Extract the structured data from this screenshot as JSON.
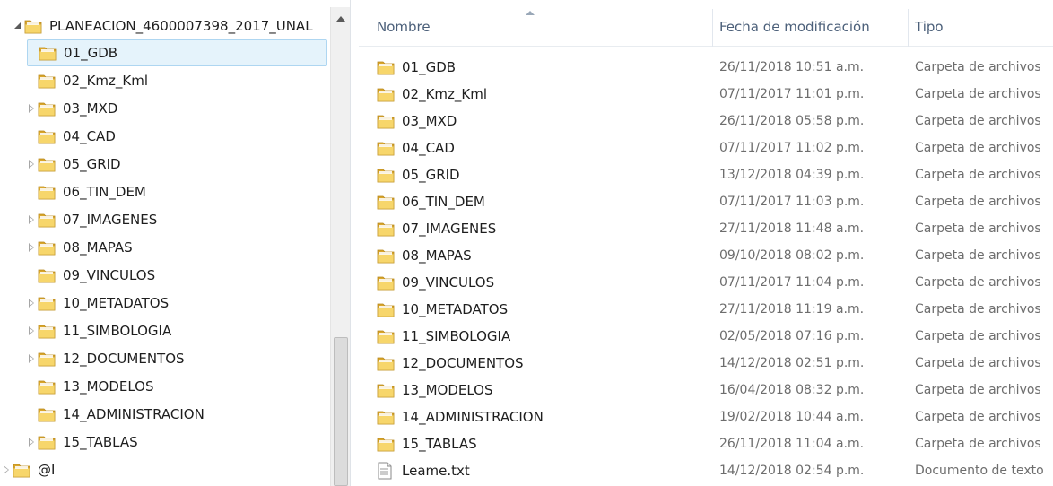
{
  "nav": {
    "root": {
      "label": "PLANEACION_4600007398_2017_UNAL"
    },
    "children": [
      {
        "label": "01_GDB",
        "expandable": false,
        "selected": true
      },
      {
        "label": "02_Kmz_Kml",
        "expandable": false
      },
      {
        "label": "03_MXD",
        "expandable": true
      },
      {
        "label": "04_CAD",
        "expandable": false
      },
      {
        "label": "05_GRID",
        "expandable": true
      },
      {
        "label": "06_TIN_DEM",
        "expandable": false
      },
      {
        "label": "07_IMAGENES",
        "expandable": true
      },
      {
        "label": "08_MAPAS",
        "expandable": true
      },
      {
        "label": "09_VINCULOS",
        "expandable": false
      },
      {
        "label": "10_METADATOS",
        "expandable": true
      },
      {
        "label": "11_SIMBOLOGIA",
        "expandable": true
      },
      {
        "label": "12_DOCUMENTOS",
        "expandable": true
      },
      {
        "label": "13_MODELOS",
        "expandable": false
      },
      {
        "label": "14_ADMINISTRACION",
        "expandable": false
      },
      {
        "label": "15_TABLAS",
        "expandable": true
      }
    ],
    "sibling": {
      "label": "@I"
    }
  },
  "columns": {
    "name": "Nombre",
    "date": "Fecha de modificación",
    "type": "Tipo"
  },
  "files": [
    {
      "name": "01_GDB",
      "date": "26/11/2018 10:51 a.m.",
      "type": "Carpeta de archivos",
      "icon": "folder-icon"
    },
    {
      "name": "02_Kmz_Kml",
      "date": "07/11/2017 11:01 p.m.",
      "type": "Carpeta de archivos",
      "icon": "folder-icon"
    },
    {
      "name": "03_MXD",
      "date": "26/11/2018 05:58 p.m.",
      "type": "Carpeta de archivos",
      "icon": "folder-icon"
    },
    {
      "name": "04_CAD",
      "date": "07/11/2017 11:02 p.m.",
      "type": "Carpeta de archivos",
      "icon": "folder-icon"
    },
    {
      "name": "05_GRID",
      "date": "13/12/2018 04:39 p.m.",
      "type": "Carpeta de archivos",
      "icon": "folder-icon"
    },
    {
      "name": "06_TIN_DEM",
      "date": "07/11/2017 11:03 p.m.",
      "type": "Carpeta de archivos",
      "icon": "folder-icon"
    },
    {
      "name": "07_IMAGENES",
      "date": "27/11/2018 11:48 a.m.",
      "type": "Carpeta de archivos",
      "icon": "folder-icon"
    },
    {
      "name": "08_MAPAS",
      "date": "09/10/2018 08:02 p.m.",
      "type": "Carpeta de archivos",
      "icon": "folder-icon"
    },
    {
      "name": "09_VINCULOS",
      "date": "07/11/2017 11:04 p.m.",
      "type": "Carpeta de archivos",
      "icon": "folder-icon"
    },
    {
      "name": "10_METADATOS",
      "date": "27/11/2018 11:19 a.m.",
      "type": "Carpeta de archivos",
      "icon": "folder-icon"
    },
    {
      "name": "11_SIMBOLOGIA",
      "date": "02/05/2018 07:16 p.m.",
      "type": "Carpeta de archivos",
      "icon": "folder-icon"
    },
    {
      "name": "12_DOCUMENTOS",
      "date": "14/12/2018 02:51 p.m.",
      "type": "Carpeta de archivos",
      "icon": "folder-icon"
    },
    {
      "name": "13_MODELOS",
      "date": "16/04/2018 08:32 p.m.",
      "type": "Carpeta de archivos",
      "icon": "folder-icon"
    },
    {
      "name": "14_ADMINISTRACION",
      "date": "19/02/2018 10:44 a.m.",
      "type": "Carpeta de archivos",
      "icon": "folder-icon"
    },
    {
      "name": "15_TABLAS",
      "date": "26/11/2018 11:04 a.m.",
      "type": "Carpeta de archivos",
      "icon": "folder-icon"
    },
    {
      "name": "Leame.txt",
      "date": "14/12/2018 02:54 p.m.",
      "type": "Documento de texto",
      "icon": "text-file-icon"
    }
  ],
  "colors": {
    "folder_back": "#d9a62b",
    "folder_front": "#f7d66b",
    "selection": "#e5f3fb",
    "header_text": "#4c607a"
  }
}
